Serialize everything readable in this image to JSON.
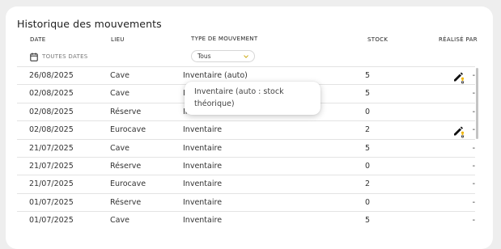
{
  "panel": {
    "title": "Historique des mouvements"
  },
  "headers": {
    "date": "DATE",
    "lieu": "LIEU",
    "type": "TYPE DE MOUVEMENT",
    "stock": "STOCK",
    "by": "RÉALISÉ PAR"
  },
  "filters": {
    "date_label": "TOUTES DATES",
    "date_icon": "calendar-icon",
    "type_value": "Tous",
    "type_icon": "chevron-down-icon"
  },
  "rows": [
    {
      "date": "26/08/2025",
      "lieu": "Cave",
      "type": "Inventaire (auto)",
      "stock": "5",
      "by": "-",
      "icon": "pencil-bulb-icon"
    },
    {
      "date": "02/08/2025",
      "lieu": "Cave",
      "type": "Inventaire",
      "stock": "5",
      "by": "-",
      "icon": ""
    },
    {
      "date": "02/08/2025",
      "lieu": "Réserve",
      "type": "Inventaire",
      "stock": "0",
      "by": "-",
      "icon": ""
    },
    {
      "date": "02/08/2025",
      "lieu": "Eurocave",
      "type": "Inventaire",
      "stock": "2",
      "by": "-",
      "icon": "pencil-bulb-icon"
    },
    {
      "date": "21/07/2025",
      "lieu": "Cave",
      "type": "Inventaire",
      "stock": "5",
      "by": "-",
      "icon": ""
    },
    {
      "date": "21/07/2025",
      "lieu": "Réserve",
      "type": "Inventaire",
      "stock": "0",
      "by": "-",
      "icon": ""
    },
    {
      "date": "21/07/2025",
      "lieu": "Eurocave",
      "type": "Inventaire",
      "stock": "2",
      "by": "-",
      "icon": ""
    },
    {
      "date": "01/07/2025",
      "lieu": "Réserve",
      "type": "Inventaire",
      "stock": "0",
      "by": "-",
      "icon": ""
    },
    {
      "date": "01/07/2025",
      "lieu": "Cave",
      "type": "Inventaire",
      "stock": "5",
      "by": "-",
      "icon": ""
    }
  ],
  "tooltip": {
    "text": "Inventaire (auto : stock théorique)"
  },
  "colors": {
    "background": "#eeeeee",
    "card": "#ffffff",
    "accent_yellow": "#f0b400"
  }
}
